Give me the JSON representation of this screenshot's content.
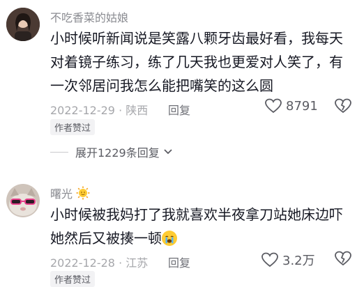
{
  "comments": [
    {
      "username": "不吃香菜的姑娘",
      "content": "小时候听新闻说是笑露八颗牙齿最好看，我每天对着镜子练习，练了几天我也更爱对人笑了，有一次邻居问我怎么能把嘴笑的这么圆",
      "date": "2022-12-29",
      "location": "陕西",
      "reply_label": "回复",
      "likes": "8791",
      "badge": "作者赞过",
      "expand_label": "展开1229条回复"
    },
    {
      "username": "曙光",
      "username_emoji": "sun-emoji",
      "content": "小时候被我妈打了我就喜欢半夜拿刀站她床边吓她然后又被揍一顿",
      "content_emoji": "crying-face-emoji",
      "date": "2022-12-28",
      "location": "江苏",
      "reply_label": "回复",
      "likes": "3.2万",
      "badge": "作者赞过"
    }
  ],
  "colors": {
    "text": "#161823",
    "muted": "#a6a7ab",
    "username": "#8a8b91",
    "badge_bg": "#f2f2f4"
  }
}
